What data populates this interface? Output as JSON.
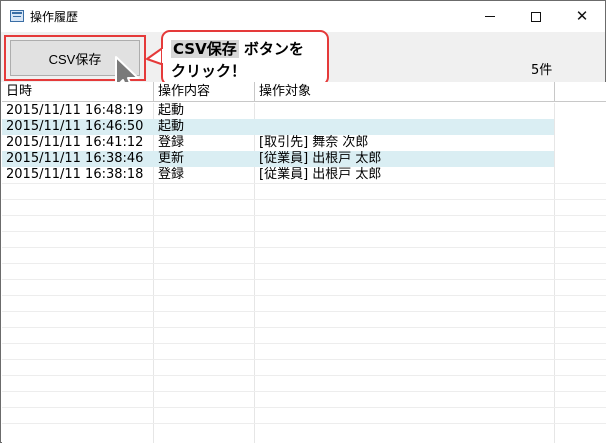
{
  "window": {
    "title": "操作履歴",
    "icon": "app-window-icon",
    "controls": {
      "minimize": "minimize-icon",
      "maximize": "maximize-icon",
      "close": "close-icon"
    }
  },
  "toolbar": {
    "csv_button_label": "CSV保存",
    "record_count": "5件",
    "highlight_color": "#e53a3a"
  },
  "callout": {
    "highlight": "CSV保存",
    "line1_rest": " ボタンを",
    "line2": "クリック！"
  },
  "table": {
    "columns": [
      "日時",
      "操作内容",
      "操作対象"
    ],
    "rows": [
      {
        "datetime": "2015/11/11 16:48:19",
        "operation": "起動",
        "target": ""
      },
      {
        "datetime": "2015/11/11 16:46:50",
        "operation": "起動",
        "target": ""
      },
      {
        "datetime": "2015/11/11 16:41:12",
        "operation": "登録",
        "target": "[取引先] 舞奈 次郎"
      },
      {
        "datetime": "2015/11/11 16:38:46",
        "operation": "更新",
        "target": "[従業員] 出根戸 太郎"
      },
      {
        "datetime": "2015/11/11 16:38:18",
        "operation": "登録",
        "target": "[従業員] 出根戸 太郎"
      }
    ],
    "alt_row_color": "#daeef3"
  }
}
